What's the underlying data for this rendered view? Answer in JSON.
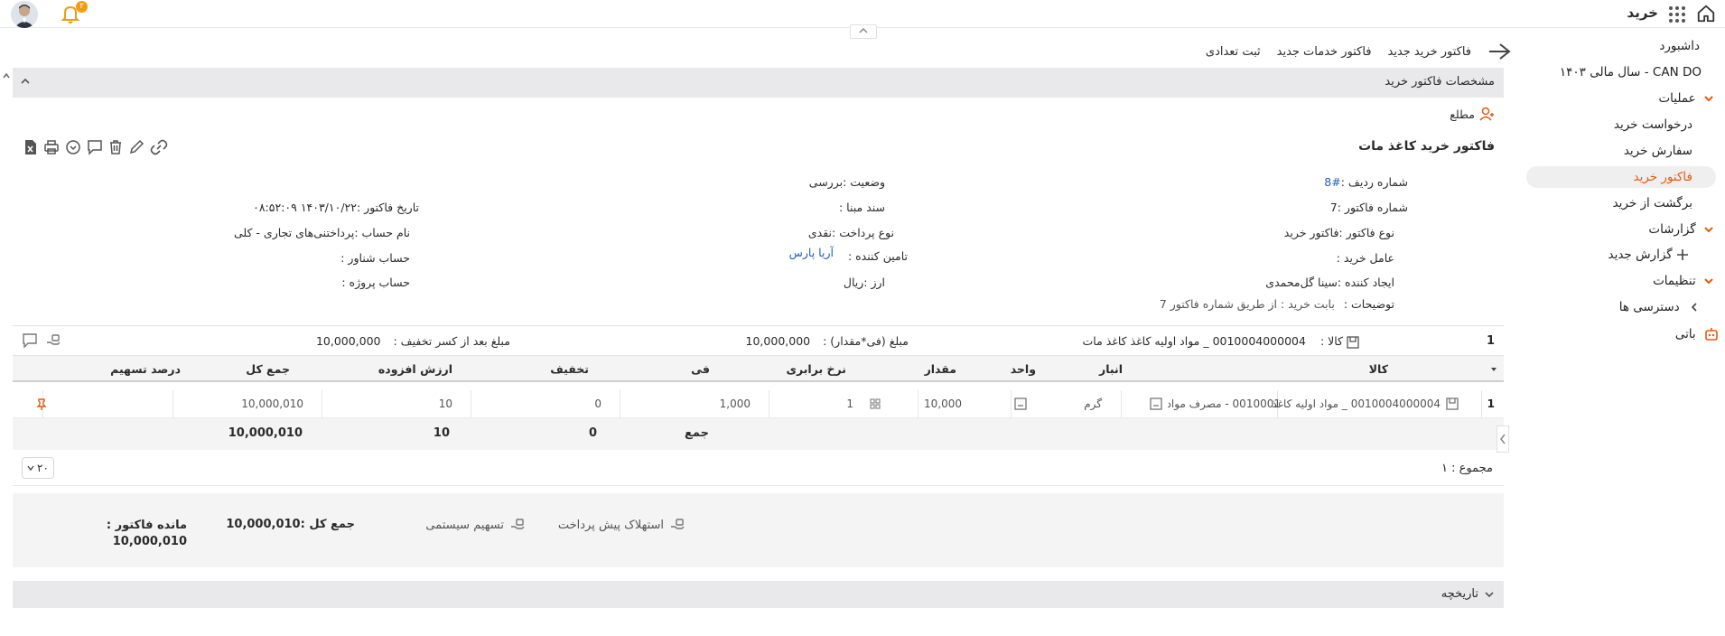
{
  "app": {
    "title": "خرید",
    "notification_count": "۲"
  },
  "sidebar": {
    "dashboard": "داشبورد",
    "fiscal_year": "CAN DO - سال مالی ۱۴۰۳",
    "operations": "عملیات",
    "purchase_request": "درخواست خرید",
    "purchase_order": "سفارش خرید",
    "purchase_invoice": "فاکتور خرید",
    "purchase_return": "برگشت از خرید",
    "reports": "گزارشات",
    "new_report": "گزارش جدید",
    "settings": "تنظیمات",
    "access": "دسترسی ها",
    "bot": "باتی"
  },
  "toolbar": {
    "new_invoice": "فاکتور خرید جدید",
    "new_service_invoice": "فاکتور خدمات جدید",
    "bulk_register": "ثبت تعدادی"
  },
  "invoice_section": {
    "header": "مشخصات فاکتور خرید",
    "informed": "مطلع",
    "title": "فاکتور خرید کاغذ مات",
    "fields": {
      "row_no_label": "شماره ردیف :",
      "row_no_value": "#8",
      "invoice_no": "شماره فاکتور :7",
      "invoice_type": "نوع فاکتور :فاکتور خرید",
      "buyer": "عامل خرید :",
      "creator": "ایجاد کننده :سینا گل‌محمدی",
      "description_label": "توضیحات :",
      "description_value": "بابت خرید : از طریق شماره فاکتور 7",
      "status": "وضعیت :بررسی",
      "base_doc": "سند مبنا :",
      "payment_type": "نوع پرداخت :نقدی",
      "supplier_label": "تامین کننده :",
      "supplier_value": "آریا پارس",
      "currency": "ارز :ریال",
      "invoice_date": "تاریخ فاکتور :۱۴۰۳/۱۰/۲۲ ۰۸:۵۲:۰۹",
      "account_name": "نام حساب :پرداختنی‌های تجاری - کلی",
      "floating_account": "حساب شناور :",
      "project_account": "حساب پروژه :"
    }
  },
  "item_summary": {
    "index": "1",
    "product_label": "کالا :",
    "product_value": "0010004000004 _ مواد اولیه کاغذ کاغذ مات",
    "amount_label": "مبلغ (فی*مقدار) :",
    "amount_value": "10,000,000",
    "after_discount_label": "مبلغ بعد از کسر تخفیف :",
    "after_discount_value": "10,000,000"
  },
  "table": {
    "headers": {
      "product": "کالا",
      "warehouse": "انبار",
      "unit": "واحد",
      "quantity": "مقدار",
      "rate": "نرخ برابری",
      "price": "فی",
      "discount": "تخفیف",
      "vat": "ارزش افزوده",
      "total": "جمع کل",
      "share_percent": "درصد تسهیم"
    },
    "row": {
      "index": "1",
      "product": "0010004000004 _ مواد اولیه کاغذ",
      "warehouse": "0010001 - مصرف مواد",
      "unit": "گرم",
      "quantity": "10,000",
      "rate": "1",
      "price": "1,000",
      "discount": "0",
      "vat": "10",
      "total": "10,000,010"
    },
    "sum": {
      "label": "جمع",
      "discount": "0",
      "vat": "10",
      "total": "10,000,010"
    }
  },
  "pagination": {
    "count_label": "مجموع : ۱",
    "page_size": "۲۰"
  },
  "footer": {
    "prepayment": "استهلاک پیش پرداخت",
    "system_share": "تسهیم سیستمی",
    "grand_total": "جمع کل :10,000,010",
    "remaining_label": "مانده فاکتور :",
    "remaining_value": "10,000,010"
  },
  "history": {
    "label": "تاریخچه"
  }
}
